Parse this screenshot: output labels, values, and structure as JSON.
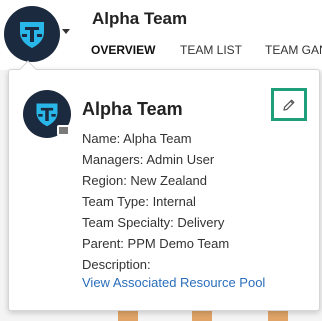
{
  "header": {
    "team_name": "Alpha Team",
    "tabs": [
      {
        "label": "OVERVIEW",
        "active": true
      },
      {
        "label": "TEAM LIST",
        "active": false
      },
      {
        "label": "TEAM GAN",
        "active": false
      }
    ]
  },
  "popup": {
    "title": "Alpha Team",
    "details": [
      "Name: Alpha Team",
      "Managers: Admin User",
      "Region: New Zealand",
      "Team Type: Internal",
      "Team Specialty: Delivery",
      "Parent: PPM Demo Team",
      "Description:"
    ],
    "link_label": "View Associated Resource Pool",
    "edit_icon": "pencil-icon"
  },
  "colors": {
    "avatar_bg": "#1c2a3f",
    "logo": "#29b6e8",
    "edit_highlight": "#1f9e7a",
    "link": "#2a6ebb",
    "bar_accent": "#e0a468"
  }
}
